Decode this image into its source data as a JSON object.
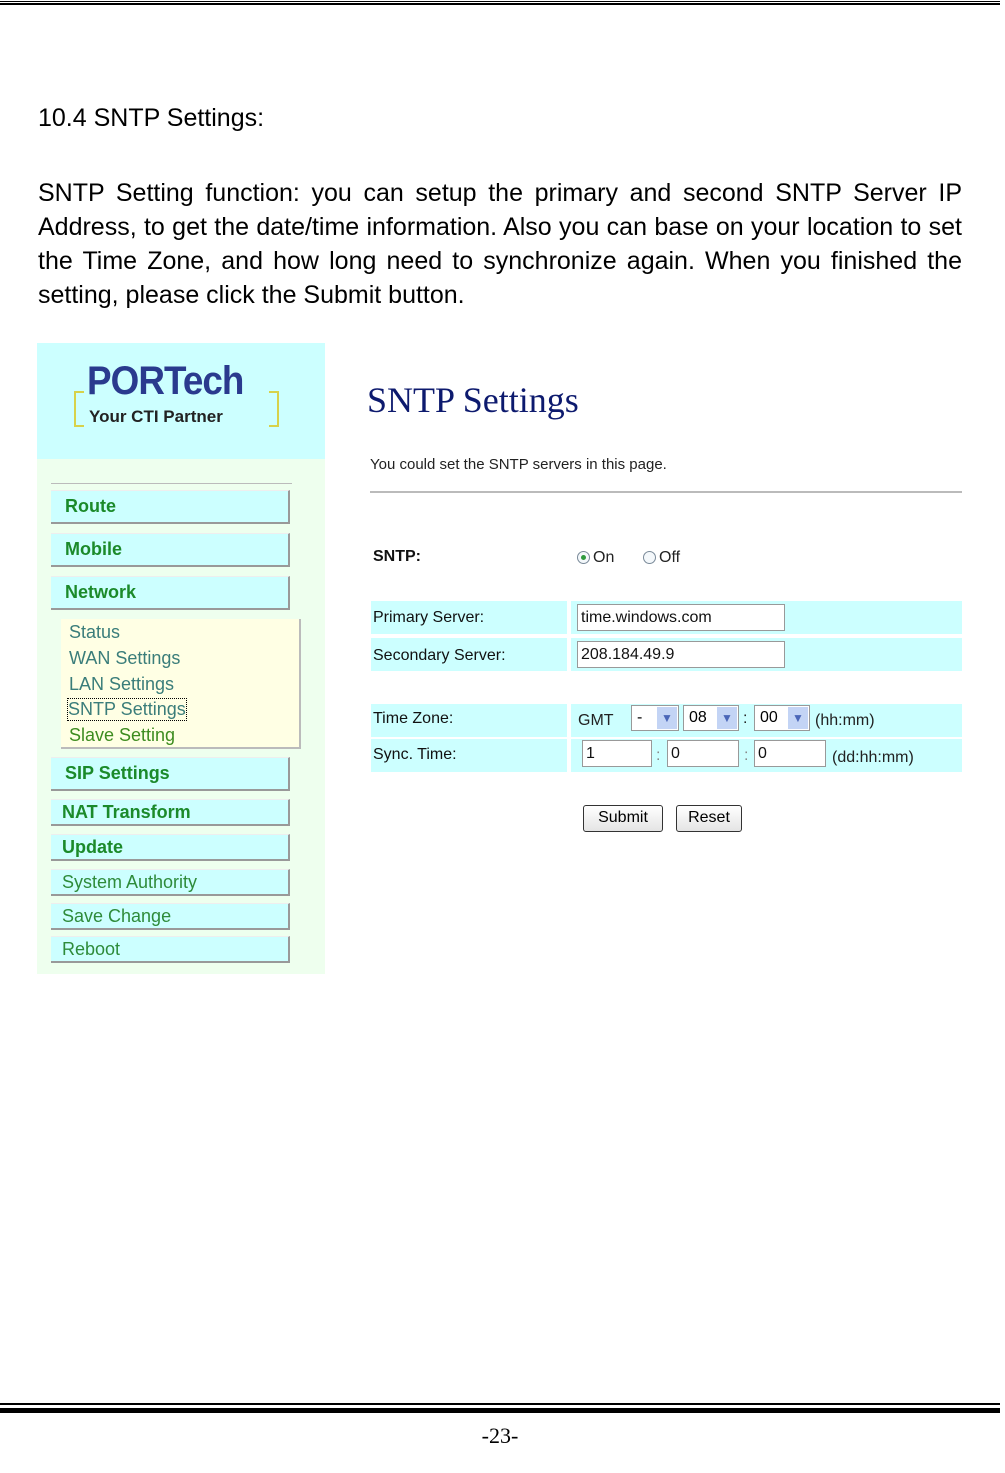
{
  "document": {
    "section_heading": "10.4 SNTP Settings:",
    "intro_paragraph": "SNTP Setting function: you can setup the primary and second SNTP Server IP Address, to get the date/time information. Also you can base on your location to set the Time Zone, and how long need to synchronize again. When you finished the setting, please click the Submit button.",
    "page_number": "-23-"
  },
  "screenshot": {
    "logo": {
      "brand": "PORTech",
      "tagline": "Your CTI Partner"
    },
    "sidebar": {
      "items": [
        {
          "label": "Route"
        },
        {
          "label": "Mobile"
        },
        {
          "label": "Network"
        },
        {
          "label": "SIP Settings"
        },
        {
          "label": "NAT Transform"
        },
        {
          "label": "Update"
        },
        {
          "label": "System Authority"
        },
        {
          "label": "Save Change"
        },
        {
          "label": "Reboot"
        }
      ],
      "network_submenu": [
        {
          "label": "Status"
        },
        {
          "label": "WAN Settings"
        },
        {
          "label": "LAN Settings"
        },
        {
          "label": "SNTP Settings",
          "selected": true
        },
        {
          "label": "Slave Setting"
        }
      ]
    },
    "main": {
      "title": "SNTP Settings",
      "description": "You could set the SNTP servers in this page.",
      "sntp": {
        "label": "SNTP:",
        "options": [
          "On",
          "Off"
        ],
        "selected": "On"
      },
      "primary_server": {
        "label": "Primary Server:",
        "value": "time.windows.com"
      },
      "secondary_server": {
        "label": "Secondary Server:",
        "value": "208.184.49.9"
      },
      "time_zone": {
        "label": "Time Zone:",
        "prefix": "GMT",
        "sign": "-",
        "hours": "08",
        "separator": ":",
        "minutes": "00",
        "format_hint": "(hh:mm)"
      },
      "sync_time": {
        "label": "Sync. Time:",
        "days": "1",
        "hours": "0",
        "minutes": "0",
        "separator": ":",
        "format_hint": "(dd:hh:mm)"
      },
      "buttons": {
        "submit": "Submit",
        "reset": "Reset"
      }
    }
  }
}
